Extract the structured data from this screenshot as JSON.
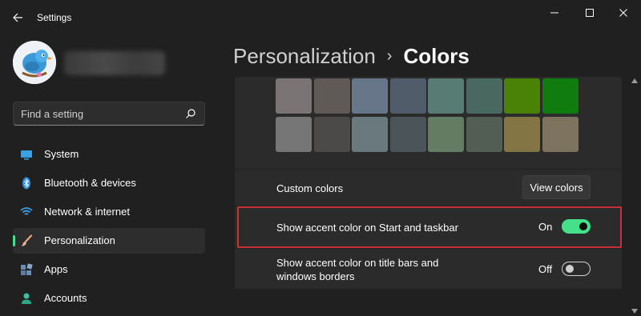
{
  "window": {
    "title": "Settings",
    "controls": [
      "minimize",
      "maximize",
      "close"
    ]
  },
  "user": {
    "avatar_icon": "bird-avatar-icon",
    "name_redacted": true
  },
  "search": {
    "placeholder": "Find a setting"
  },
  "sidebar": {
    "items": [
      {
        "label": "System",
        "icon": "monitor-icon",
        "active": false
      },
      {
        "label": "Bluetooth & devices",
        "icon": "bluetooth-icon",
        "active": false
      },
      {
        "label": "Network & internet",
        "icon": "wifi-icon",
        "active": false
      },
      {
        "label": "Personalization",
        "icon": "brush-icon",
        "active": true
      },
      {
        "label": "Apps",
        "icon": "apps-icon",
        "active": false
      },
      {
        "label": "Accounts",
        "icon": "person-icon",
        "active": false
      }
    ]
  },
  "breadcrumb": {
    "parent": "Personalization",
    "separator": "›",
    "current": "Colors"
  },
  "accent_colors": {
    "rows": [
      [
        "#7b7475",
        "#5f5a57",
        "#68768a",
        "#515c6b",
        "#567c73",
        "#486860",
        "#498205",
        "#107c10"
      ],
      [
        "#767676",
        "#4c4a48",
        "#69797e",
        "#4a5459",
        "#647c64",
        "#525e54",
        "#847545",
        "#7e735f"
      ]
    ]
  },
  "custom_colors": {
    "label": "Custom colors",
    "button_label": "View colors"
  },
  "accent_start_taskbar": {
    "label": "Show accent color on Start and taskbar",
    "state_label": "On",
    "checked": true
  },
  "accent_title_bars": {
    "label_line1": "Show accent color on title bars and",
    "label_line2": "windows borders",
    "state_label": "Off",
    "checked": false
  },
  "colors": {
    "accent": "#45e08a",
    "highlight_border": "#c8303a",
    "background": "#202020",
    "card": "#2b2b2b"
  }
}
